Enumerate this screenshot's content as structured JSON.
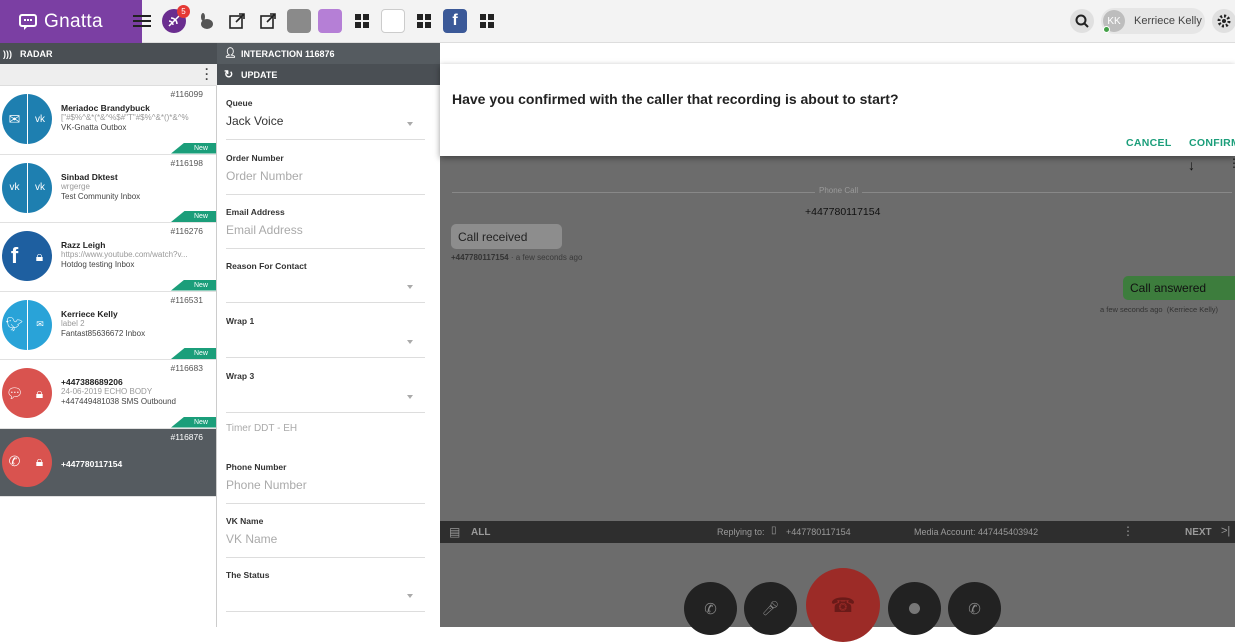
{
  "brand": {
    "name": "Gnatta",
    "color": "#7b3fa3"
  },
  "topbar": {
    "notifications_count": "5",
    "user": {
      "initials": "KK",
      "name": "Kerriece Kelly"
    }
  },
  "radar": {
    "title": "RADAR",
    "items": [
      {
        "id": "#116099",
        "name": "Meriadoc Brandybuck",
        "line2": "[\"#$%^&*(*&^%$#\"T\"#$%^&*()*&^%",
        "line3": "VK-Gnatta Outbox",
        "badge": "New"
      },
      {
        "id": "#116198",
        "name": "Sinbad Dktest",
        "line2": "wrgerge",
        "line3": "Test Community Inbox",
        "badge": "New"
      },
      {
        "id": "#116276",
        "name": "Razz Leigh",
        "line2": "https://www.youtube.com/watch?v...",
        "line3": "Hotdog testing Inbox",
        "badge": "New"
      },
      {
        "id": "#116531",
        "name": "Kerriece Kelly",
        "line2": "label 2",
        "line3": "Fantast85636672 Inbox",
        "badge": "New"
      },
      {
        "id": "#116683",
        "name": "+447388689206",
        "line2": "24-06-2019 ECHO BODY",
        "line3": "+447449481038 SMS Outbound",
        "badge": "New"
      },
      {
        "id": "#116876",
        "name": "+447780117154",
        "line2": "",
        "line3": "",
        "badge": ""
      }
    ]
  },
  "interaction": {
    "title": "INTERACTION 116876",
    "update_title": "UPDATE",
    "fields": [
      {
        "label": "Queue",
        "value": "Jack Voice",
        "placeholder": ""
      },
      {
        "label": "Order Number",
        "value": "",
        "placeholder": "Order Number"
      },
      {
        "label": "Email Address",
        "value": "",
        "placeholder": "Email Address"
      },
      {
        "label": "Reason For Contact",
        "value": "",
        "placeholder": ""
      },
      {
        "label": "Wrap 1",
        "value": "",
        "placeholder": ""
      },
      {
        "label": "Wrap 3",
        "value": "",
        "placeholder": ""
      },
      {
        "label": "",
        "value": "",
        "placeholder": "Timer DDT - EH"
      },
      {
        "label": "Phone Number",
        "value": "",
        "placeholder": "Phone Number"
      },
      {
        "label": "VK Name",
        "value": "",
        "placeholder": "VK Name"
      },
      {
        "label": "The Status",
        "value": "",
        "placeholder": ""
      }
    ]
  },
  "dialog": {
    "question": "Have you confirmed with the caller that recording is about to start?",
    "cancel": "CANCEL",
    "confirm": "CONFIRM"
  },
  "conversation": {
    "divider_label": "Phone Call",
    "number": "+447780117154",
    "received": {
      "text": "Call received",
      "from": "+447780117154",
      "time": "a few seconds ago"
    },
    "answered": {
      "text": "Call answered",
      "time": "a few seconds ago",
      "by": "(Kerriece Kelly)"
    }
  },
  "reply_bar": {
    "all": "ALL",
    "replying_to_label": "Replying to:",
    "replying_to": "+447780117154",
    "media_account": "Media Account: 447445403942",
    "next": "NEXT"
  }
}
